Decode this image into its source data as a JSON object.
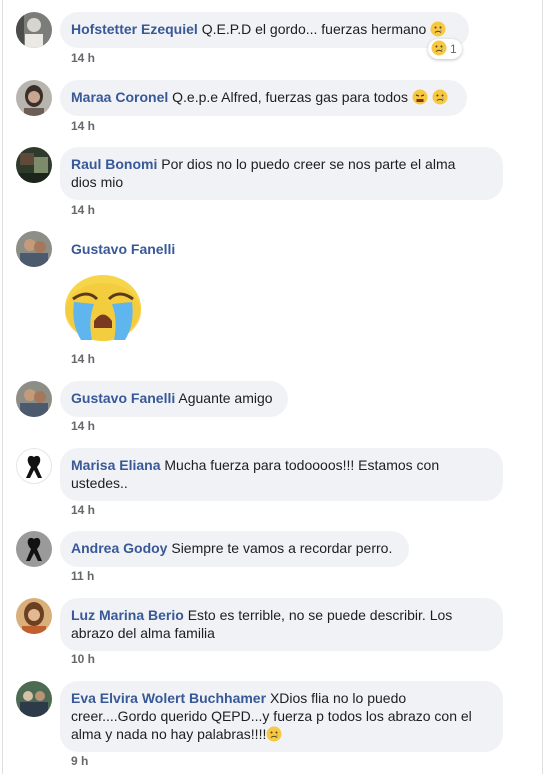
{
  "comments": [
    {
      "author": "Hofstetter Ezequiel",
      "text": "Q.E.P.D el gordo... fuerzas hermano",
      "time": "14 h",
      "reaction_count": "1"
    },
    {
      "author": "Maraa Coronel",
      "text": "Q.e.p.e Alfred, fuerzas gas para todos",
      "time": "14 h"
    },
    {
      "author": "Raul Bonomi",
      "text_line1": "Por dios no lo puedo creer se nos parte el alma",
      "text_line2": "dios mio",
      "time": "14 h"
    },
    {
      "author": "Gustavo Fanelli",
      "time": "14 h"
    },
    {
      "author": "Gustavo Fanelli",
      "text": "Aguante amigo",
      "time": "14 h"
    },
    {
      "author": "Marisa Eliana",
      "text_line1": "Mucha fuerza para todoooos!!! Estamos con",
      "text_line2": "ustedes..",
      "time": "14 h"
    },
    {
      "author": "Andrea Godoy",
      "text": "Siempre te vamos a recordar perro.",
      "time": "11 h"
    },
    {
      "author": "Luz Marina Berio",
      "text_line1": "Esto es terrible, no se puede describir. Los",
      "text_line2": "abrazo del alma familia",
      "time": "10 h"
    },
    {
      "author": "Eva Elvira Wolert Buchhamer",
      "text_line1": "XDios flia no lo puedo",
      "text_line2": "creer....Gordo querido QEPD...y fuerza p todos los abrazo con el",
      "text_line3": "alma y nada no hay palabras!!!!",
      "time": "9 h"
    }
  ],
  "colors": {
    "author": "#385898",
    "bubble": "#f0f2f5",
    "time": "#65676b",
    "emoji": "#f7c842"
  },
  "icons": [
    "crying-face-emoji",
    "tired-face-emoji",
    "large-crying-face-sticker",
    "black-ribbon-avatar"
  ]
}
